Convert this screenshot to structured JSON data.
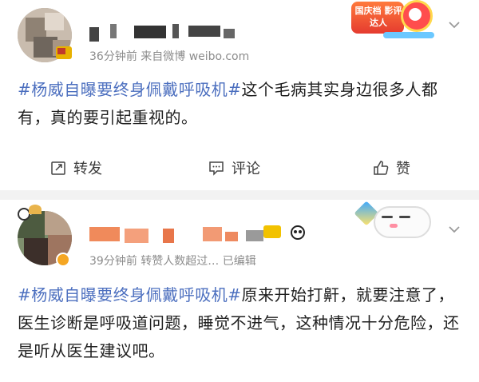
{
  "posts": [
    {
      "meta": "36分钟前  来自微博 weibo.com",
      "hashtag": "#杨威自曝要终身佩戴呼吸机#",
      "text": "这个毛病其实身边很多人都有，真的要引起重视的。",
      "badge_text": "国庆档 影评达人",
      "actions": {
        "repost": "转发",
        "comment": "评论",
        "like": "赞"
      }
    },
    {
      "meta": "39分钟前  转赞人数超过…  已编辑",
      "hashtag": "#杨威自曝要终身佩戴呼吸机#",
      "text": "原来开始打鼾，就要注意了，医生诊断是呼吸道问题，睡觉不进气，这种情况十分危险，还是听从医生建议吧。"
    }
  ],
  "colors": {
    "link": "#4c6fbf",
    "meta": "#8c8c8c",
    "separator": "#f2f2f2"
  },
  "icons": [
    "chevron-down-icon",
    "repost-icon",
    "comment-icon",
    "like-icon",
    "panda-icon",
    "sleeping-pet-sticker"
  ]
}
